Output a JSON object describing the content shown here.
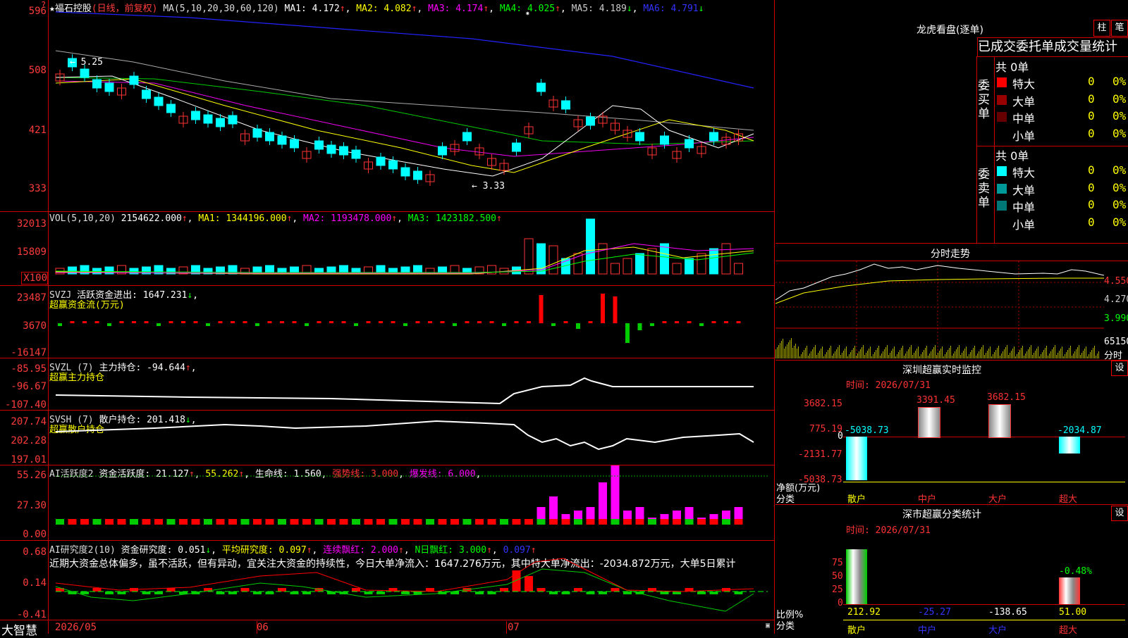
{
  "header": {
    "stock_name": "福石控股",
    "mode": "(日线，前复权)",
    "ma_title": "MA(5,10,20,30,60,120)",
    "ma1": "MA1: 4.172",
    "ma2": "MA2: 4.082",
    "ma3": "MA3: 4.174",
    "ma4": "MA4: 4.025",
    "ma5": "MA5: 4.189",
    "ma6": "MA6: 4.791",
    "question_mark": "?",
    "star": "★"
  },
  "price_axis": {
    "labels": [
      "596",
      "508",
      "421",
      "333"
    ],
    "high_note": "5.25",
    "low_note": "3.33"
  },
  "vol": {
    "title": "VOL(5,10,20)",
    "value": "2154622.000",
    "ma1": "MA1: 1344196.000",
    "ma2": "MA2: 1193478.000",
    "ma3": "MA3: 1423182.500",
    "axis": [
      "32013",
      "15809",
      "X100"
    ]
  },
  "svzj": {
    "title": "SVZJ",
    "label": "活跃资金进出: 1647.231",
    "sub": "超赢资金流(万元)",
    "axis": [
      "23487",
      "3670",
      "-16147"
    ]
  },
  "svzl": {
    "title": "SVZL (7)",
    "label": "主力持仓: -94.644",
    "sub": "超赢主力持仓",
    "axis": [
      "-85.95",
      "-96.67",
      "-107.40"
    ]
  },
  "svsh": {
    "title": "SVSH (7)",
    "label": "散户持仓: 201.418",
    "sub": "超赢散户持仓",
    "axis": [
      "207.74",
      "202.28",
      "197.01"
    ]
  },
  "ai_active": {
    "title": "AI活跃度2",
    "label": "资金活跃度: 21.127",
    "v2": "55.262",
    "life": "生命线: 1.560",
    "strong": "强势线: 3.000",
    "burst": "爆发线: 6.000",
    "axis": [
      "55.26",
      "27.30",
      "0.00"
    ]
  },
  "ai_research": {
    "title": "AI研究度2(10)",
    "label": "资金研究度: 0.051",
    "avg": "平均研究度: 0.097",
    "consec": "连续飘红: 2.000",
    "nday": "N日飘红: 3.000",
    "v5": "0.097",
    "comment": "近期大资金总体偏多，虽不活跃，但有异动，宜关注大资金的持续性，今日大单净流入：1647.276万元，其中特大单净流出：-2034.872万元，大单5日累计",
    "axis": [
      "0.68",
      "0.14",
      "-0.41"
    ]
  },
  "time_axis": {
    "brand": "大智慧",
    "labels": [
      "2026/05",
      "06",
      "07"
    ]
  },
  "dragon": {
    "title": "龙虎看盘(逐单)",
    "btn1": "柱",
    "btn2": "笔",
    "tabs": "已成交委托单成交量统计",
    "buy_side": "委买单",
    "sell_side": "委卖单",
    "buy_total": "共 0单",
    "sell_total": "共 0单",
    "buy_rows": [
      {
        "label": "特大",
        "count": "0",
        "pct": "0%",
        "color": "#ff0000"
      },
      {
        "label": "大单",
        "count": "0",
        "pct": "0%",
        "color": "#990000"
      },
      {
        "label": "中单",
        "count": "0",
        "pct": "0%",
        "color": "#660000"
      },
      {
        "label": "小单",
        "count": "0",
        "pct": "0%",
        "color": ""
      }
    ],
    "sell_rows": [
      {
        "label": "特大",
        "count": "0",
        "pct": "0%",
        "color": "#00ffff"
      },
      {
        "label": "大单",
        "count": "0",
        "pct": "0%",
        "color": "#009999"
      },
      {
        "label": "中单",
        "count": "0",
        "pct": "0%",
        "color": "#007777"
      },
      {
        "label": "小单",
        "count": "0",
        "pct": "0%",
        "color": ""
      }
    ]
  },
  "intraday": {
    "title": "分时走势",
    "axis": [
      "4.550",
      "4.270",
      "3.990",
      "65150"
    ],
    "footer": "分时"
  },
  "sz_monitor": {
    "title": "深圳超赢实时监控",
    "set": "设",
    "time": "时间: 2026/07/31",
    "axis": [
      "3682.15",
      "775.19",
      "0",
      "-2131.77",
      "-5038.73"
    ],
    "values": [
      "-5038.73",
      "3391.45",
      "3682.15",
      "-2034.87"
    ],
    "unit": "净额(万元)",
    "cat_label": "分类",
    "cats": [
      "散户",
      "中户",
      "大户",
      "超大"
    ]
  },
  "sz_class": {
    "title": "深市超赢分类统计",
    "set": "设",
    "time": "时间: 2026/07/31",
    "axis": [
      "75",
      "50",
      "25",
      "0"
    ],
    "top_val": "-0.48%",
    "values": [
      "212.92",
      "-25.27",
      "-138.65",
      "51.00"
    ],
    "unit": "比例%",
    "cat_label": "分类",
    "cats": [
      "散户",
      "中户",
      "大户",
      "超大"
    ]
  }
}
